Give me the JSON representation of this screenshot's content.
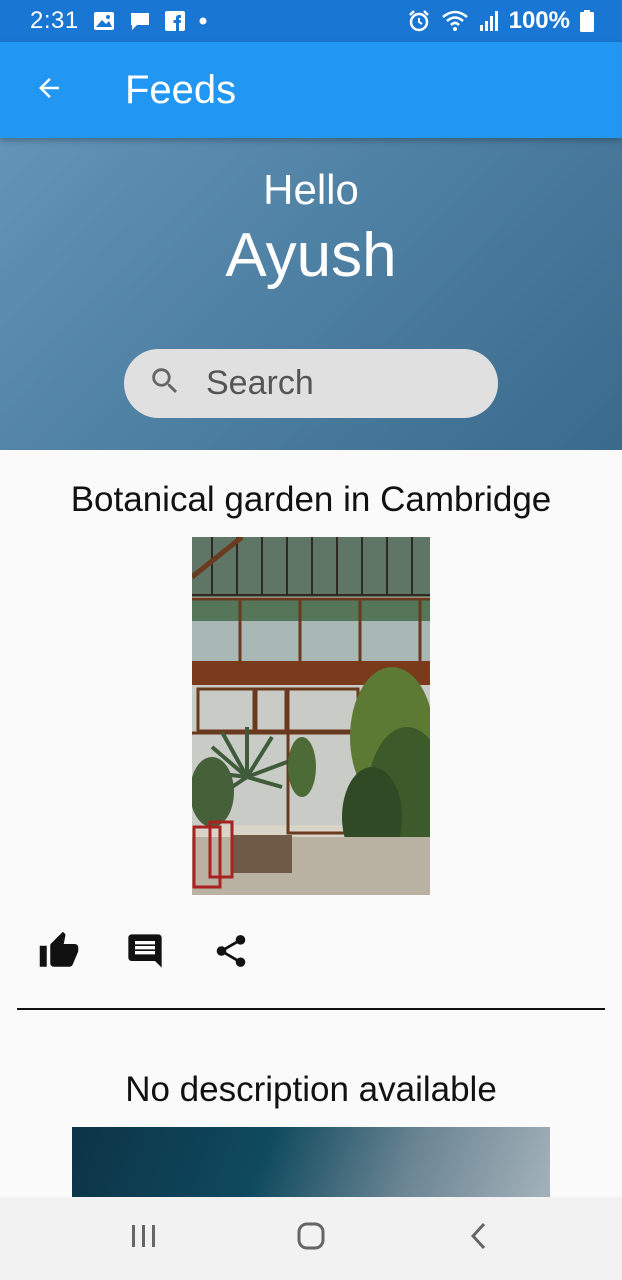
{
  "status_bar": {
    "time": "2:31",
    "battery_percent": "100%",
    "left_icons": [
      "image-icon",
      "chat-icon",
      "facebook-icon",
      "dot-icon"
    ],
    "right_icons": [
      "alarm-icon",
      "wifi-icon",
      "signal-icon",
      "battery-icon"
    ]
  },
  "app_bar": {
    "title": "Feeds",
    "back_icon": "arrow-back-icon",
    "color": "#2196f3"
  },
  "hero": {
    "greeting": "Hello",
    "name": "Ayush",
    "search_placeholder": "Search"
  },
  "posts": [
    {
      "title": "Botanical garden in Cambridge",
      "actions": [
        "like-icon",
        "comment-icon",
        "share-icon"
      ]
    },
    {
      "title": "No description available"
    }
  ],
  "nav_bar": {
    "buttons": [
      "recent-apps-icon",
      "home-icon",
      "back-icon"
    ]
  }
}
